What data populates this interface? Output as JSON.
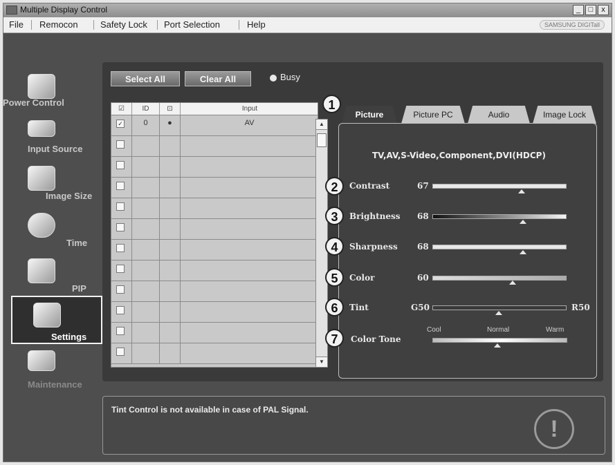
{
  "window": {
    "title": "Multiple Display Control",
    "min": "_",
    "max": "□",
    "close": "x"
  },
  "menu": {
    "items": [
      "File",
      "Remocon",
      "Safety Lock",
      "Port Selection",
      "Help"
    ],
    "brand": "SAMSUNG DIGITall"
  },
  "sidebar": {
    "items": [
      {
        "label": "Power Control",
        "icon": "power-icon"
      },
      {
        "label": "Input Source",
        "icon": "input-source-icon"
      },
      {
        "label": "Image Size",
        "icon": "image-size-icon"
      },
      {
        "label": "Time",
        "icon": "clock-icon"
      },
      {
        "label": "PIP",
        "icon": "pip-icon"
      },
      {
        "label": "Settings",
        "icon": "settings-icon",
        "active": true
      },
      {
        "label": "Maintenance",
        "icon": "maintenance-icon"
      }
    ]
  },
  "toolbar": {
    "select_all": "Select All",
    "clear_all": "Clear All",
    "busy": "Busy"
  },
  "grid": {
    "headers": {
      "check": "☑",
      "id": "ID",
      "status": "⊡",
      "input": "Input"
    },
    "rows": [
      {
        "checked": true,
        "id": "0",
        "status": "●",
        "input": "AV"
      },
      {},
      {},
      {},
      {},
      {},
      {},
      {},
      {},
      {},
      {},
      {}
    ]
  },
  "tabs": [
    "Picture",
    "Picture PC",
    "Audio",
    "Image Lock"
  ],
  "settings": {
    "sources": "TV,AV,S-Video,Component,DVI(HDCP)",
    "params": [
      {
        "num": "2",
        "label": "Contrast",
        "value": "67",
        "pos": 0.67
      },
      {
        "num": "3",
        "label": "Brightness",
        "value": "68",
        "pos": 0.68
      },
      {
        "num": "4",
        "label": "Sharpness",
        "value": "68",
        "pos": 0.68
      },
      {
        "num": "5",
        "label": "Color",
        "value": "60",
        "pos": 0.6
      },
      {
        "num": "6",
        "label": "Tint",
        "value": "G50",
        "right": "R50",
        "pos": 0.5
      }
    ],
    "tone": {
      "num": "7",
      "label": "Color Tone",
      "options": [
        "Cool",
        "Normal",
        "Warm"
      ],
      "selected": "Normal"
    },
    "callout_tabs": "1"
  },
  "message": {
    "text": "Tint Control is not available in case of PAL Signal.",
    "icon": "!"
  }
}
